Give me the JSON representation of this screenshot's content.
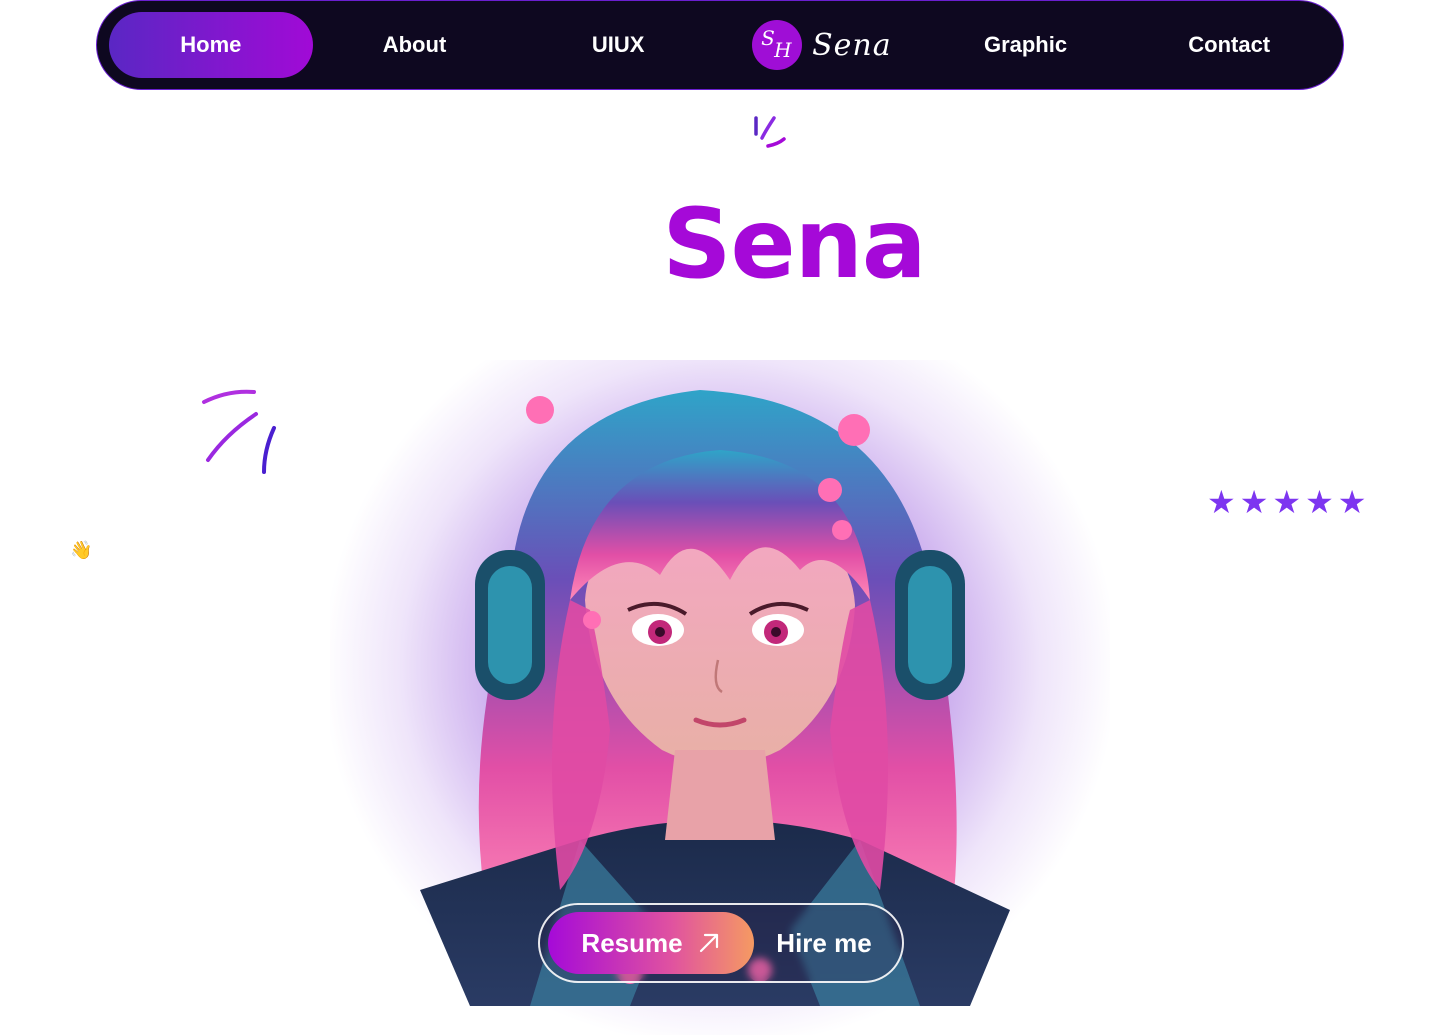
{
  "nav": {
    "items": [
      {
        "label": "Home",
        "active": true
      },
      {
        "label": "About"
      },
      {
        "label": "UIUX"
      },
      {
        "label": "Graphic"
      },
      {
        "label": "Contact"
      }
    ],
    "brand": {
      "badge_s": "S",
      "badge_h": "H",
      "name": "Sena"
    }
  },
  "hero": {
    "title": "Sena",
    "wave_emoji": "👋",
    "rating_stars": 5,
    "star_glyph": "★"
  },
  "cta": {
    "resume_label": "Resume",
    "hire_label": "Hire me"
  },
  "colors": {
    "accent": "#a509d8",
    "nav_bg": "#0e0820",
    "star": "#7d35f0"
  },
  "icons": [
    "arrow-up-right-icon",
    "star-icon",
    "wave-hand-icon"
  ]
}
